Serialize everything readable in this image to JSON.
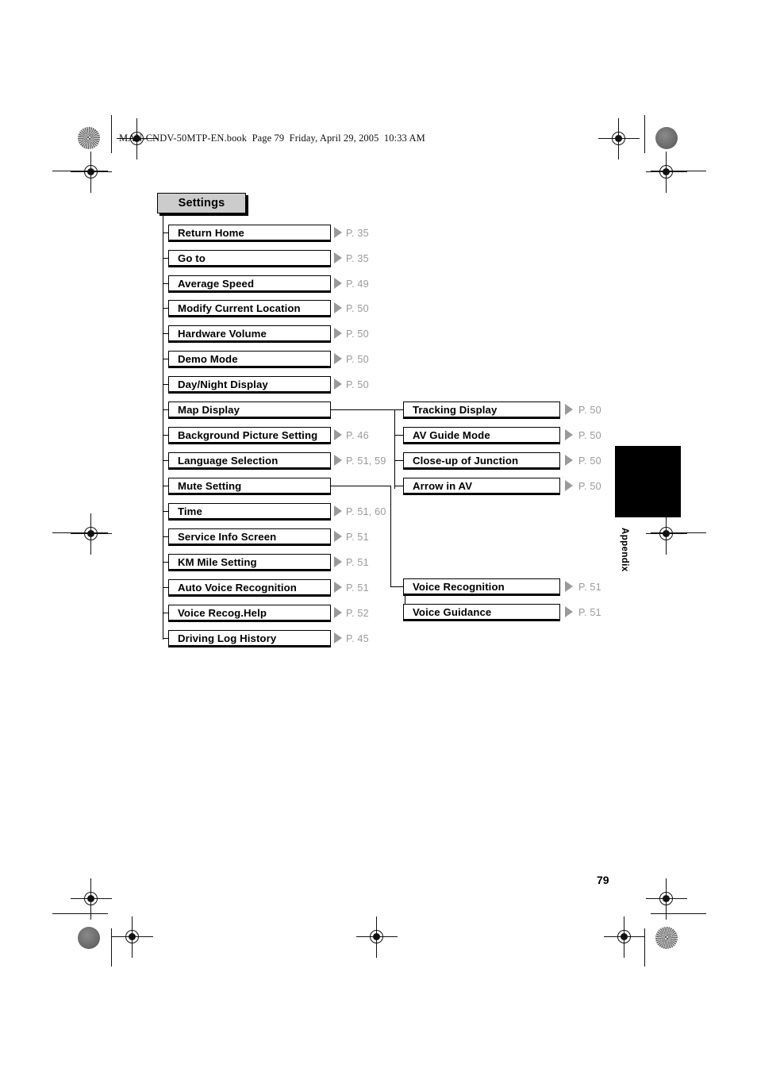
{
  "document": {
    "book_header": "MAN-CNDV-50MTP-EN.book  Page 79  Friday, April 29, 2005  10:33 AM",
    "folio": "79",
    "side_tab_label": "Appendix",
    "colors": {
      "title_fill": "#cccccc",
      "node_fill": "#ffffff",
      "line": "#000000",
      "pageref_text": "#9a9a9a",
      "tab_fill": "#000000"
    }
  },
  "chart_data": {
    "type": "diagram",
    "title": "Settings",
    "root": {
      "label": "Settings",
      "page": ""
    },
    "level1": [
      {
        "label": "Return Home",
        "page": "P. 35",
        "has_children": false
      },
      {
        "label": "Go to",
        "page": "P. 35",
        "has_children": false
      },
      {
        "label": "Average Speed",
        "page": "P. 49",
        "has_children": false
      },
      {
        "label": "Modify Current Location",
        "page": "P. 50",
        "has_children": false
      },
      {
        "label": "Hardware Volume",
        "page": "P. 50",
        "has_children": false
      },
      {
        "label": "Demo Mode",
        "page": "P. 50",
        "has_children": false
      },
      {
        "label": "Day/Night Display",
        "page": "P. 50",
        "has_children": false
      },
      {
        "label": "Map Display",
        "page": "",
        "has_children": true
      },
      {
        "label": "Background Picture Setting",
        "page": "P. 46",
        "has_children": false
      },
      {
        "label": "Language Selection",
        "page": "P. 51, 59",
        "has_children": false
      },
      {
        "label": "Mute Setting",
        "page": "",
        "has_children": true
      },
      {
        "label": "Time",
        "page": "P. 51, 60",
        "has_children": false
      },
      {
        "label": "Service Info Screen",
        "page": "P. 51",
        "has_children": false
      },
      {
        "label": "KM Mile Setting",
        "page": "P. 51",
        "has_children": false
      },
      {
        "label": "Auto Voice Recognition",
        "page": "P. 51",
        "has_children": false
      },
      {
        "label": "Voice Recog.Help",
        "page": "P. 52",
        "has_children": false
      },
      {
        "label": "Driving Log History",
        "page": "P. 45",
        "has_children": false
      }
    ],
    "map_display_children": [
      {
        "label": "Tracking Display",
        "page": "P. 50"
      },
      {
        "label": "AV Guide Mode",
        "page": "P. 50"
      },
      {
        "label": "Close-up of Junction",
        "page": "P. 50"
      },
      {
        "label": "Arrow in AV",
        "page": "P. 50"
      }
    ],
    "mute_setting_children": [
      {
        "label": "Voice Recognition",
        "page": "P. 51"
      },
      {
        "label": "Voice Guidance",
        "page": "P. 51"
      }
    ]
  }
}
